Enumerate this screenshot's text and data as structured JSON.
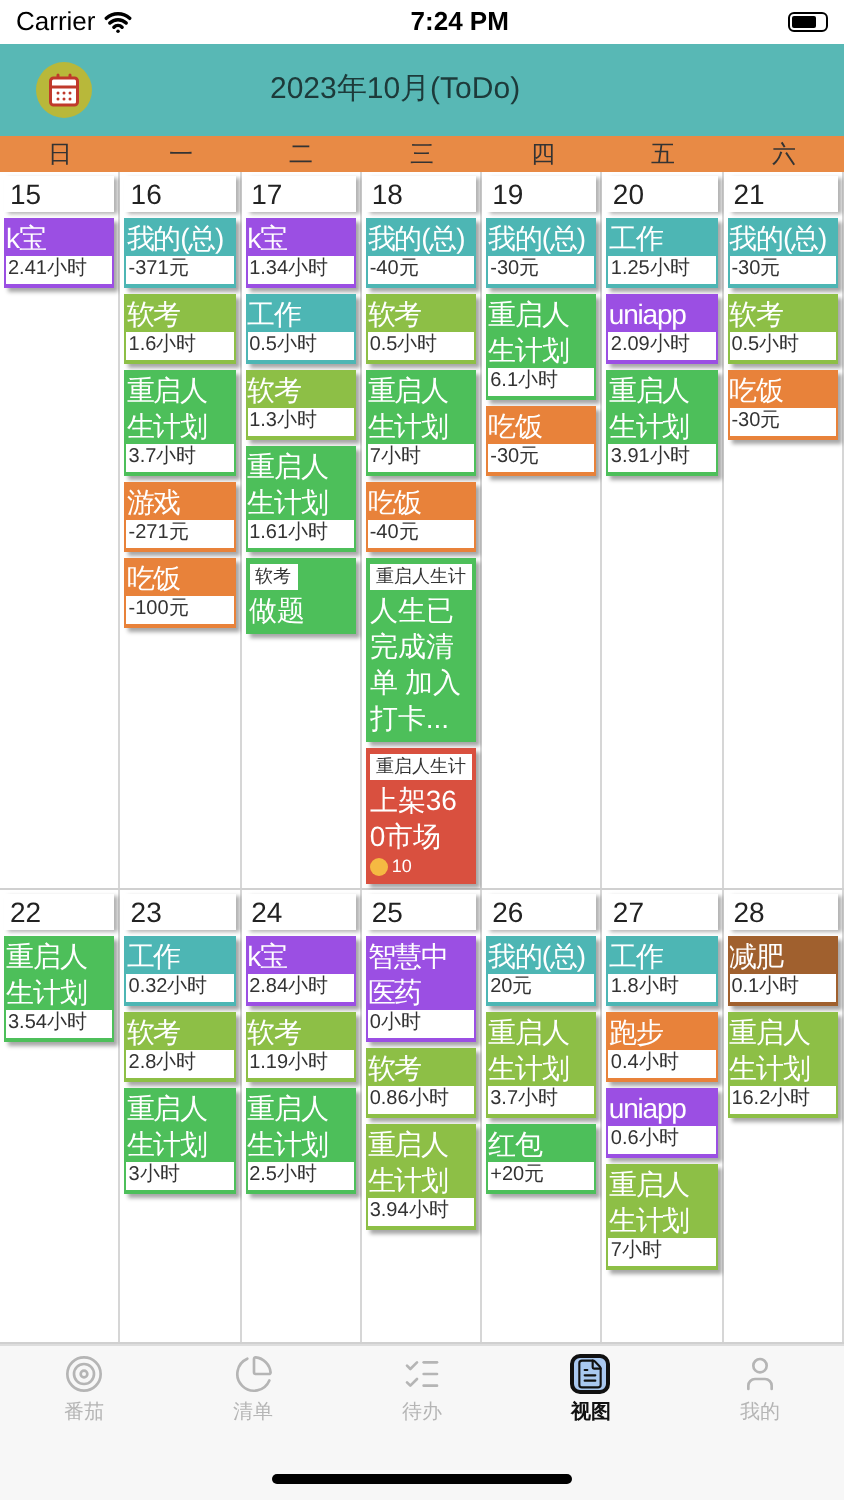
{
  "status_bar": {
    "carrier": "Carrier",
    "time": "7:24 PM"
  },
  "header": {
    "title": "2023年10月(ToDo)"
  },
  "weekdays": [
    "日",
    "一",
    "二",
    "三",
    "四",
    "五",
    "六"
  ],
  "weeks": [
    {
      "days": [
        {
          "date": "15",
          "entries": [
            {
              "kind": "stat",
              "title": "k宝",
              "value": "2.41小时",
              "color": "#9b4fe3"
            }
          ]
        },
        {
          "date": "16",
          "entries": [
            {
              "kind": "stat",
              "title": "我的(总)",
              "value": "-371元",
              "color": "#4db6b4"
            },
            {
              "kind": "stat",
              "title": "软考",
              "value": "1.6小时",
              "color": "#8dbf46"
            },
            {
              "kind": "stat",
              "title": "重启人生计划",
              "value": "3.7小时",
              "color": "#4dbf5a"
            },
            {
              "kind": "stat",
              "title": "游戏",
              "value": "-271元",
              "color": "#e8823a"
            },
            {
              "kind": "stat",
              "title": "吃饭",
              "value": "-100元",
              "color": "#e8823a"
            }
          ]
        },
        {
          "date": "17",
          "entries": [
            {
              "kind": "stat",
              "title": "k宝",
              "value": "1.34小时",
              "color": "#9b4fe3"
            },
            {
              "kind": "stat",
              "title": "工作",
              "value": "0.5小时",
              "color": "#4db6b4"
            },
            {
              "kind": "stat",
              "title": "软考",
              "value": "1.3小时",
              "color": "#8dbf46"
            },
            {
              "kind": "stat",
              "title": "重启人生计划",
              "value": "1.61小时",
              "color": "#4dbf5a"
            },
            {
              "kind": "todo",
              "tag": "软考",
              "text": "做题",
              "color": "#4dbf5a"
            }
          ]
        },
        {
          "date": "18",
          "entries": [
            {
              "kind": "stat",
              "title": "我的(总)",
              "value": "-40元",
              "color": "#4db6b4"
            },
            {
              "kind": "stat",
              "title": "软考",
              "value": "0.5小时",
              "color": "#8dbf46"
            },
            {
              "kind": "stat",
              "title": "重启人生计划",
              "value": "7小时",
              "color": "#4dbf5a"
            },
            {
              "kind": "stat",
              "title": "吃饭",
              "value": "-40元",
              "color": "#e8823a"
            },
            {
              "kind": "todo",
              "tag": "重启人生计",
              "text": "人生已完成清单 加入打卡...",
              "color": "#4dbf5a"
            },
            {
              "kind": "todo",
              "tag": "重启人生计",
              "text": "上架360市场",
              "badge": "10",
              "color": "#d9503f"
            }
          ]
        },
        {
          "date": "19",
          "entries": [
            {
              "kind": "stat",
              "title": "我的(总)",
              "value": "-30元",
              "color": "#4db6b4"
            },
            {
              "kind": "stat",
              "title": "重启人生计划",
              "value": "6.1小时",
              "color": "#4dbf5a"
            },
            {
              "kind": "stat",
              "title": "吃饭",
              "value": "-30元",
              "color": "#e8823a"
            }
          ]
        },
        {
          "date": "20",
          "entries": [
            {
              "kind": "stat",
              "title": "工作",
              "value": "1.25小时",
              "color": "#4db6b4"
            },
            {
              "kind": "stat",
              "title": "uniapp",
              "value": "2.09小时",
              "color": "#9b4fe3"
            },
            {
              "kind": "stat",
              "title": "重启人生计划",
              "value": "3.91小时",
              "color": "#4dbf5a"
            }
          ]
        },
        {
          "date": "21",
          "entries": [
            {
              "kind": "stat",
              "title": "我的(总)",
              "value": "-30元",
              "color": "#4db6b4"
            },
            {
              "kind": "stat",
              "title": "软考",
              "value": "0.5小时",
              "color": "#8dbf46"
            },
            {
              "kind": "stat",
              "title": "吃饭",
              "value": "-30元",
              "color": "#e8823a"
            }
          ]
        }
      ]
    },
    {
      "days": [
        {
          "date": "22",
          "entries": [
            {
              "kind": "stat",
              "title": "重启人生计划",
              "value": "3.54小时",
              "color": "#4dbf5a"
            }
          ]
        },
        {
          "date": "23",
          "entries": [
            {
              "kind": "stat",
              "title": "工作",
              "value": "0.32小时",
              "color": "#4db6b4"
            },
            {
              "kind": "stat",
              "title": "软考",
              "value": "2.8小时",
              "color": "#8dbf46"
            },
            {
              "kind": "stat",
              "title": "重启人生计划",
              "value": "3小时",
              "color": "#4dbf5a"
            }
          ]
        },
        {
          "date": "24",
          "entries": [
            {
              "kind": "stat",
              "title": "k宝",
              "value": "2.84小时",
              "color": "#9b4fe3"
            },
            {
              "kind": "stat",
              "title": "软考",
              "value": "1.19小时",
              "color": "#8dbf46"
            },
            {
              "kind": "stat",
              "title": "重启人生计划",
              "value": "2.5小时",
              "color": "#4dbf5a"
            }
          ]
        },
        {
          "date": "25",
          "entries": [
            {
              "kind": "stat",
              "title": "智慧中医药",
              "value": "0小时",
              "color": "#9b4fe3"
            },
            {
              "kind": "stat",
              "title": "软考",
              "value": "0.86小时",
              "color": "#8dbf46"
            },
            {
              "kind": "stat",
              "title": "重启人生计划",
              "value": "3.94小时",
              "color": "#8dbf46"
            }
          ]
        },
        {
          "date": "26",
          "entries": [
            {
              "kind": "stat",
              "title": "我的(总)",
              "value": "20元",
              "color": "#4db6b4"
            },
            {
              "kind": "stat",
              "title": "重启人生计划",
              "value": "3.7小时",
              "color": "#8dbf46"
            },
            {
              "kind": "stat",
              "title": "红包",
              "value": "+20元",
              "color": "#4dbf5a"
            }
          ]
        },
        {
          "date": "27",
          "entries": [
            {
              "kind": "stat",
              "title": "工作",
              "value": "1.8小时",
              "color": "#4db6b4"
            },
            {
              "kind": "stat",
              "title": "跑步",
              "value": "0.4小时",
              "color": "#e8823a"
            },
            {
              "kind": "stat",
              "title": "uniapp",
              "value": "0.6小时",
              "color": "#9b4fe3"
            },
            {
              "kind": "stat",
              "title": "重启人生计划",
              "value": "7小时",
              "color": "#8dbf46"
            }
          ]
        },
        {
          "date": "28",
          "entries": [
            {
              "kind": "stat",
              "title": "减肥",
              "value": "0.1小时",
              "color": "#a0602e"
            },
            {
              "kind": "stat",
              "title": "重启人生计划",
              "value": "16.2小时",
              "color": "#8dbf46"
            }
          ]
        }
      ]
    }
  ],
  "tabs": [
    {
      "label": "番茄",
      "selected": false
    },
    {
      "label": "清单",
      "selected": false
    },
    {
      "label": "待办",
      "selected": false
    },
    {
      "label": "视图",
      "selected": true
    },
    {
      "label": "我的",
      "selected": false
    }
  ]
}
